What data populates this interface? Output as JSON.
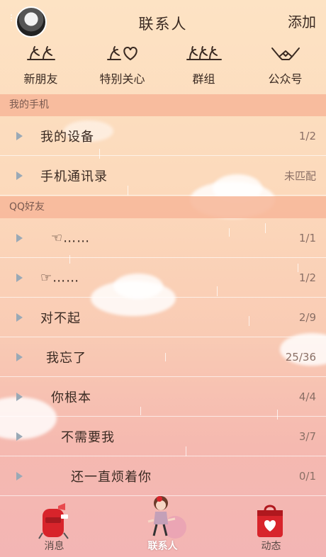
{
  "header": {
    "title": "联系人",
    "add_label": "添加",
    "menu_dots": "⋮"
  },
  "shortcuts": [
    {
      "label": "新朋友",
      "icon": "two-people-icon"
    },
    {
      "label": "特别关心",
      "icon": "heart-person-icon"
    },
    {
      "label": "群组",
      "icon": "group-icon"
    },
    {
      "label": "公众号",
      "icon": "public-account-icon"
    }
  ],
  "sections": [
    {
      "title": "我的手机",
      "rows": [
        {
          "name": "我的设备",
          "count": "1/2"
        },
        {
          "name": "手机通讯录",
          "count": "未匹配"
        }
      ]
    },
    {
      "title": "QQ好友",
      "rows": [
        {
          "name": "☜……",
          "count": "1/1"
        },
        {
          "name": "☞……",
          "count": "1/2"
        },
        {
          "name": "对不起",
          "count": "2/9"
        },
        {
          "name": "我忘了",
          "count": "25/36"
        },
        {
          "name": "你根本",
          "count": "4/4"
        },
        {
          "name": "不需要我",
          "count": "3/7"
        },
        {
          "name": "还一直烦着你",
          "count": "0/1"
        }
      ]
    }
  ],
  "tabs": [
    {
      "label": "消息",
      "icon": "mailbox-icon",
      "active": false
    },
    {
      "label": "联系人",
      "icon": "girl-on-ball-icon",
      "active": true
    },
    {
      "label": "动态",
      "icon": "heart-bag-icon",
      "active": false
    }
  ],
  "colors": {
    "section_header": "#f7b79a",
    "arrow": "#9aa9b6",
    "accent_red": "#d8242b"
  }
}
